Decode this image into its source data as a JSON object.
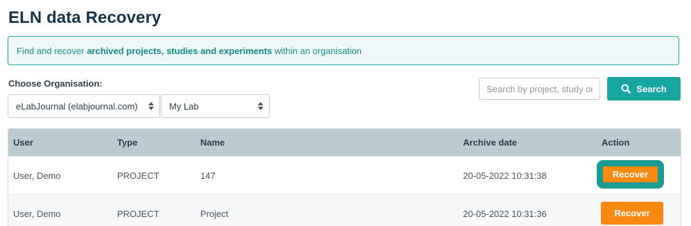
{
  "page": {
    "title": "ELN data Recovery"
  },
  "info": {
    "prefix": "Find and recover ",
    "highlight": "archived projects, studies and experiments",
    "suffix": " within an organisation"
  },
  "filters": {
    "org_label": "Choose Organisation:",
    "organisation_selected": "eLabJournal (elabjournal.com)",
    "lab_selected": "My Lab"
  },
  "search": {
    "placeholder": "Search by project, study or experiment",
    "button_label": "Search",
    "icon": "search-icon"
  },
  "table": {
    "headers": {
      "user": "User",
      "type": "Type",
      "name": "Name",
      "archive_date": "Archive date",
      "action": "Action"
    },
    "rows": [
      {
        "user": "User, Demo",
        "type": "PROJECT",
        "name": "147",
        "archive_date": "20-05-2022 10:31:38",
        "action": "Recover"
      },
      {
        "user": "User, Demo",
        "type": "PROJECT",
        "name": "Project",
        "archive_date": "20-05-2022 10:31:36",
        "action": "Recover"
      }
    ]
  },
  "colors": {
    "accent": "#17a6a0",
    "recover": "#f98a11",
    "highlight_ring": "#1b9b93",
    "header_bg": "#bccbd2",
    "title": "#163449"
  }
}
